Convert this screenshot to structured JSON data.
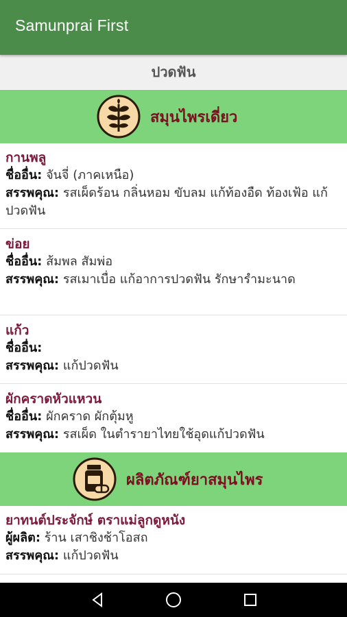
{
  "app": {
    "title": "Samunprai First"
  },
  "page": {
    "title": "ปวดฟัน"
  },
  "sections": [
    {
      "label": "สมุนไพรเดี่ยว",
      "icon": "herb-leaf-icon"
    },
    {
      "label": "ผลิตภัณฑ์ยาสมุนไพร",
      "icon": "medicine-bottle-icon"
    }
  ],
  "labels": {
    "other_name": "ชื่ออื่น:",
    "property": "สรรพคุณ:",
    "producer": "ผู้ผลิต:"
  },
  "herbs": [
    {
      "name": "กานพลู",
      "other": "จันจี่ (ภาคเหนือ)",
      "property": "รสเผ็ดร้อน กลิ่นหอม ขับลม แก้ท้องอืด ท้องเฟ้อ แก้ปวดฟัน"
    },
    {
      "name": "ข่อย",
      "other": "ส้มพล สัมพ่อ",
      "property": "รสเมาเบื่อ แก้อาการปวดฟัน รักษารำมะนาด"
    },
    {
      "name": "แก้ว",
      "other": "",
      "property": "แก้ปวดฟัน"
    },
    {
      "name": "ผักคราดหัวแหวน",
      "other": "ผักคราด ผักตุ้มหู",
      "property": "รสเผ็ด ในตำรายาไทยใช้อุดแก้ปวดฟัน"
    }
  ],
  "products": [
    {
      "name": "ยาทนต์ประจักษ์ ตราแม่ลูกดูหนัง",
      "producer": "ร้าน เสาชิงช้าโอสถ",
      "property": "แก้ปวดฟัน"
    }
  ],
  "colors": {
    "appbar": "#4c8c4a",
    "section": "#7dd47b",
    "title": "#7b1a3a",
    "section_label": "#7a1020"
  }
}
